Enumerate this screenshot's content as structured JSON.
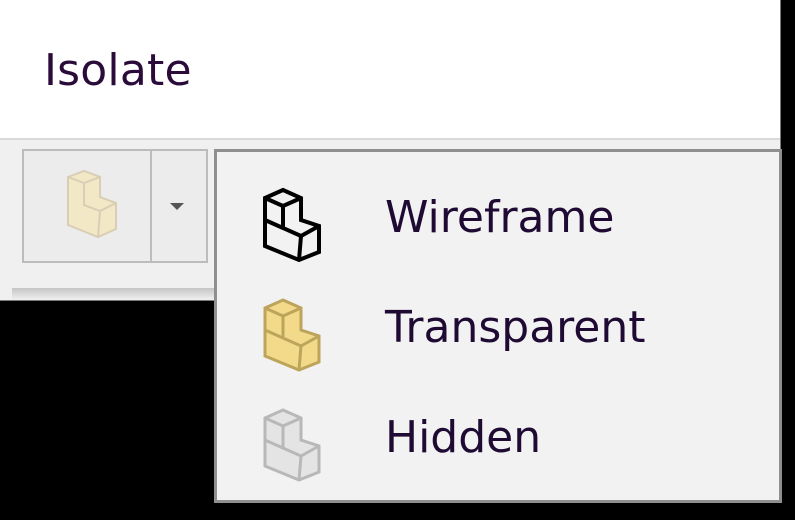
{
  "panel": {
    "title": "Isolate"
  },
  "split_button": {
    "icon": "transparent-part-icon",
    "arrow_icon": "dropdown-arrow-icon"
  },
  "menu": {
    "items": [
      {
        "label": "Wireframe",
        "icon": "wireframe-part-icon"
      },
      {
        "label": "Transparent",
        "icon": "transparent-part-icon"
      },
      {
        "label": "Hidden",
        "icon": "hidden-part-icon"
      }
    ]
  },
  "colors": {
    "title_text": "#2b0b3a",
    "menu_text": "#1f0a34",
    "transparent_fill": "#f3d98a",
    "disabled_fill": "#f2e8c6",
    "hidden_fill": "#e4e4e4"
  }
}
